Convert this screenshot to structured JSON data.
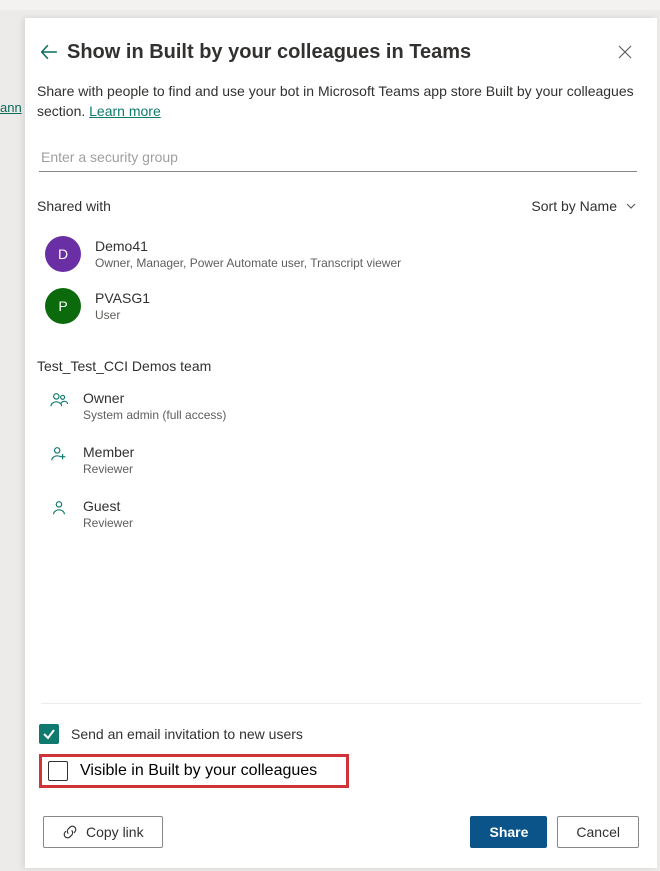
{
  "header": {
    "title": "Show in Built by your colleagues in Teams",
    "subtext_prefix": "Share with people to find and use your bot in Microsoft Teams app store Built by your colleagues section. ",
    "learn_more": "Learn more"
  },
  "search": {
    "placeholder": "Enter a security group"
  },
  "shared": {
    "label": "Shared with",
    "sort_label": "Sort by Name",
    "items": [
      {
        "initial": "D",
        "color": "#6b2fa5",
        "name": "Demo41",
        "roles": "Owner, Manager, Power Automate user, Transcript viewer"
      },
      {
        "initial": "P",
        "color": "#0b6a0b",
        "name": "PVASG1",
        "roles": "User"
      }
    ]
  },
  "team": {
    "name": "Test_Test_CCI Demos team",
    "roles": [
      {
        "name": "Owner",
        "desc": "System admin (full access)",
        "icon": "group"
      },
      {
        "name": "Member",
        "desc": "Reviewer",
        "icon": "person-add"
      },
      {
        "name": "Guest",
        "desc": "Reviewer",
        "icon": "person"
      }
    ]
  },
  "options": {
    "send_email": "Send an email invitation to new users",
    "visible_label": "Visible in Built by your colleagues"
  },
  "footer": {
    "copy_link": "Copy link",
    "share": "Share",
    "cancel": "Cancel"
  },
  "side": {
    "stub": "ann"
  }
}
